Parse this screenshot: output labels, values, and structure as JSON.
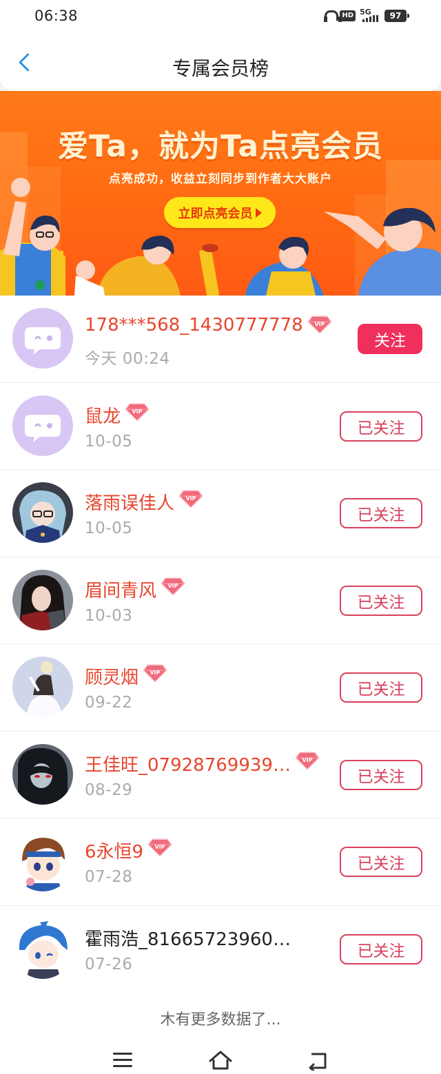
{
  "status_bar": {
    "time": "06:38",
    "hd": "HD",
    "network": "5G",
    "battery": "97"
  },
  "header": {
    "title": "专属会员榜"
  },
  "banner": {
    "headline": "爱Ta，就为Ta点亮会员",
    "subtitle": "点亮成功，收益立刻同步到作者大大账户",
    "cta": "立即点亮会员"
  },
  "members": [
    {
      "name": "178***568_1430777778",
      "vip": true,
      "date": "今天 00:24",
      "action": "关注",
      "followed": false,
      "avatar": "default-chat-avatar"
    },
    {
      "name": "鼠龙",
      "vip": true,
      "date": "10-05",
      "action": "已关注",
      "followed": true,
      "avatar": "default-chat-avatar"
    },
    {
      "name": "落雨误佳人",
      "vip": true,
      "date": "10-05",
      "action": "已关注",
      "followed": true,
      "avatar": "anime-glasses-avatar"
    },
    {
      "name": "眉间青风",
      "vip": true,
      "date": "10-03",
      "action": "已关注",
      "followed": true,
      "avatar": "dark-warrior-avatar"
    },
    {
      "name": "顾灵烟",
      "vip": true,
      "date": "09-22",
      "action": "已关注",
      "followed": true,
      "avatar": "white-robe-avatar"
    },
    {
      "name": "王佳旺_07928769939…",
      "vip": true,
      "date": "08-29",
      "action": "已关注",
      "followed": true,
      "avatar": "red-eye-avatar"
    },
    {
      "name": "6永恒9",
      "vip": true,
      "date": "07-28",
      "action": "已关注",
      "followed": true,
      "avatar": "chibi-boy-avatar"
    },
    {
      "name": "霍雨浩_81665723960…",
      "vip": false,
      "date": "07-26",
      "action": "已关注",
      "followed": true,
      "avatar": "blue-hair-chibi-avatar"
    }
  ],
  "vip_label": "VIP",
  "footer": {
    "no_more": "木有更多数据了..."
  },
  "colors": {
    "accent": "#ef2f5c",
    "name": "#e8452c",
    "banner": "#ff6a12",
    "back": "#1e8fe6"
  }
}
